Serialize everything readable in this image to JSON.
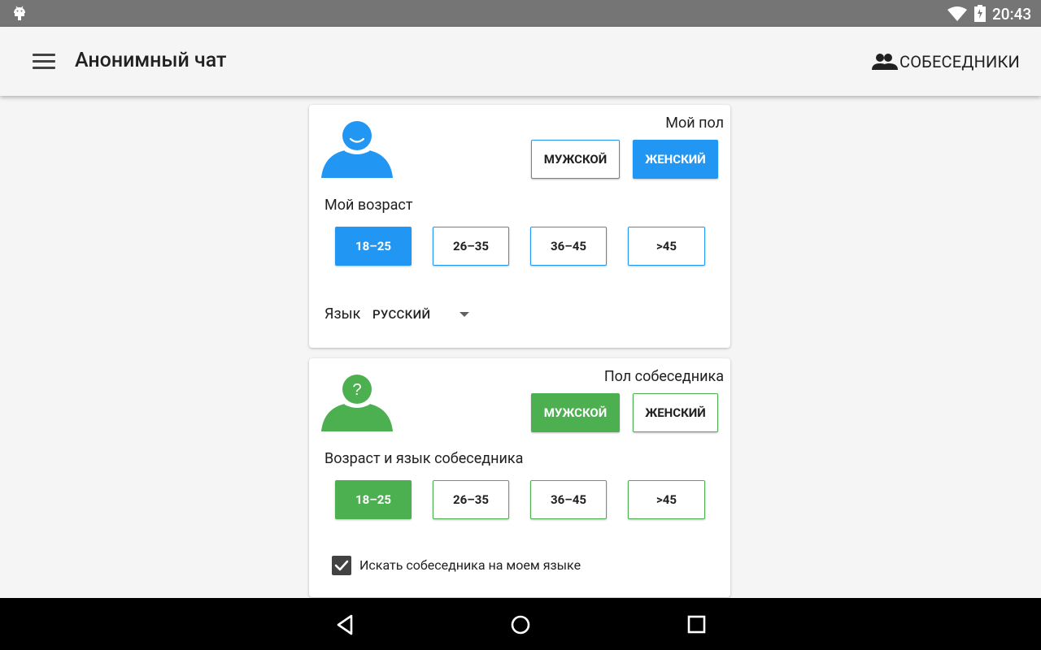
{
  "status_bar": {
    "time": "20:43",
    "icons": [
      "android-icon",
      "wifi-icon",
      "battery-icon"
    ]
  },
  "app_bar": {
    "menu_icon": "hamburger-menu-icon",
    "title": "Анонимный чат",
    "action": {
      "icon": "people-icon",
      "label": "СОБЕСЕДНИКИ"
    }
  },
  "my_profile": {
    "avatar_icon": "person-smile-icon",
    "gender_label": "Мой пол",
    "gender_options": [
      "МУЖСКОЙ",
      "ЖЕНСКИЙ"
    ],
    "gender_selected": "ЖЕНСКИЙ",
    "age_label": "Мой возраст",
    "age_options": [
      "18–25",
      "26–35",
      "36–45",
      ">45"
    ],
    "age_selected": "18–25",
    "language_label": "Язык",
    "language_value": "РУССКИЙ"
  },
  "partner_profile": {
    "avatar_icon": "person-question-icon",
    "avatar_mark": "?",
    "gender_label": "Пол собеседника",
    "gender_options": [
      "МУЖСКОЙ",
      "ЖЕНСКИЙ"
    ],
    "gender_selected": "МУЖСКОЙ",
    "age_label": "Возраст и язык собеседника",
    "age_options": [
      "18–25",
      "26–35",
      "36–45",
      ">45"
    ],
    "age_selected": "18–25",
    "same_language_checked": true,
    "same_language_label": "Искать собеседника на моем языке"
  },
  "colors": {
    "my_accent": "#2196f3",
    "partner_accent": "#4caf50",
    "status_bar": "#757575",
    "nav_bar": "#000000"
  },
  "nav_bar": {
    "buttons": [
      "back-icon",
      "home-icon",
      "recents-icon"
    ]
  }
}
